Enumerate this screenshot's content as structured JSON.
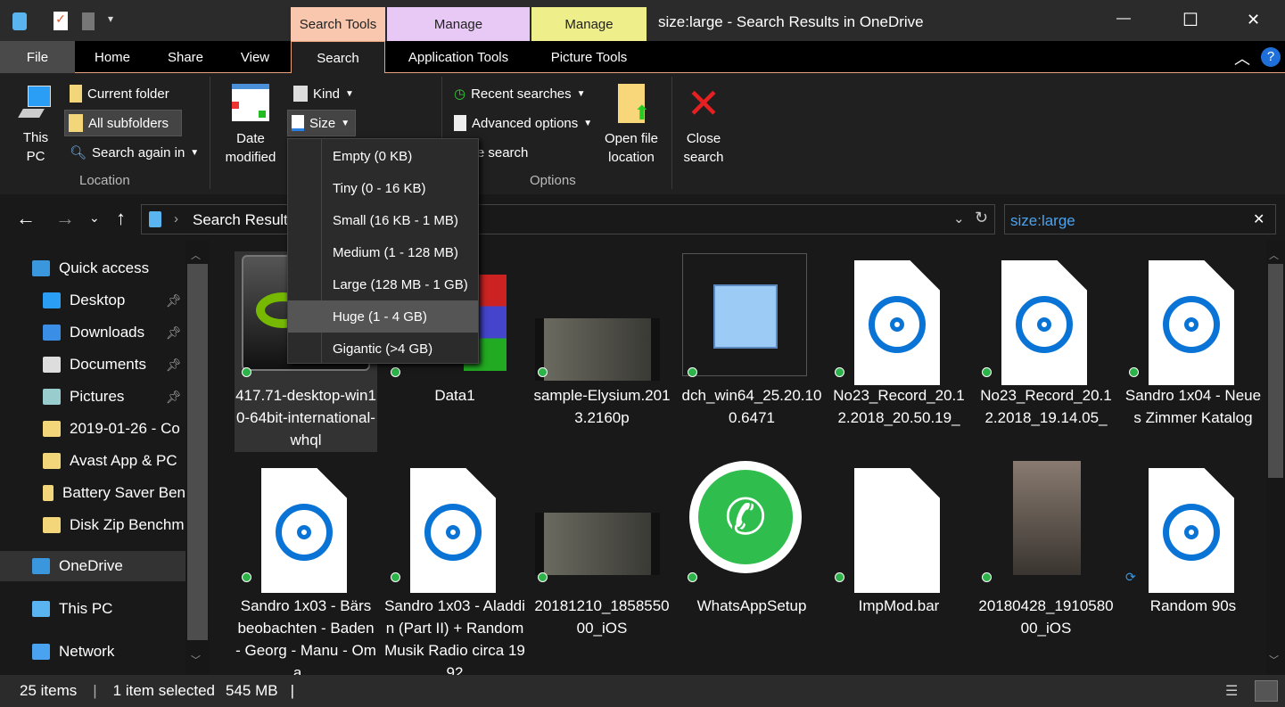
{
  "window": {
    "title": "size:large - Search Results in OneDrive",
    "minimize": "—",
    "maximize": "☐",
    "close": "✕"
  },
  "context_tabs": [
    {
      "label": "Search Tools",
      "color": "#f9c7ae"
    },
    {
      "label": "Manage",
      "color": "#e8c8f5"
    },
    {
      "label": "Manage",
      "color": "#eeee8a"
    }
  ],
  "tabs": [
    "File",
    "Home",
    "Share",
    "View",
    "Search",
    "Application Tools",
    "Picture Tools"
  ],
  "ribbon": {
    "location": {
      "this_pc": "This PC",
      "current_folder": "Current folder",
      "all_subfolders": "All subfolders",
      "search_again_in": "Search again in",
      "group": "Location"
    },
    "refine": {
      "date_modified": "Date modified",
      "kind": "Kind",
      "size": "Size"
    },
    "options": {
      "recent_searches": "Recent searches",
      "advanced_options": "Advanced options",
      "save_search": "Save search",
      "open_file_location": "Open file location",
      "group": "Options"
    },
    "close_search": "Close search"
  },
  "size_menu": [
    "Empty (0 KB)",
    "Tiny (0 - 16 KB)",
    "Small (16 KB - 1 MB)",
    "Medium (1 - 128 MB)",
    "Large (128 MB - 1 GB)",
    "Huge (1 - 4 GB)",
    "Gigantic (>4 GB)"
  ],
  "size_menu_hovered": "Huge (1 - 4 GB)",
  "address": {
    "path": "Search Results in OneDrive",
    "search_value": "size:large"
  },
  "nav": [
    {
      "label": "Quick access",
      "icon": "star-icon"
    },
    {
      "label": "Desktop",
      "icon": "desktop-icon",
      "pinned": true
    },
    {
      "label": "Downloads",
      "icon": "download-icon",
      "pinned": true
    },
    {
      "label": "Documents",
      "icon": "documents-icon",
      "pinned": true
    },
    {
      "label": "Pictures",
      "icon": "pictures-icon",
      "pinned": true
    },
    {
      "label": "2019-01-26 - Co",
      "icon": "folder-icon"
    },
    {
      "label": "Avast App & PC",
      "icon": "folder-icon"
    },
    {
      "label": "Battery Saver Ben",
      "icon": "folder-icon"
    },
    {
      "label": "Disk Zip Benchm",
      "icon": "folder-icon"
    },
    {
      "label": "OneDrive",
      "icon": "onedrive-icon"
    },
    {
      "label": "This PC",
      "icon": "pc-icon"
    },
    {
      "label": "Network",
      "icon": "network-icon"
    }
  ],
  "files": [
    {
      "name": "417.71-desktop-win10-64bit-international-whql",
      "type": "nvidia",
      "selected": true
    },
    {
      "name": "Data1",
      "type": "archive"
    },
    {
      "name": "sample-Elysium.2013.2160p",
      "type": "video"
    },
    {
      "name": "dch_win64_25.20.100.6471",
      "type": "installer"
    },
    {
      "name": "No23_Record_20.12.2018_20.50.19_",
      "type": "music"
    },
    {
      "name": "No23_Record_20.12.2018_19.14.05_",
      "type": "music"
    },
    {
      "name": "Sandro 1x04 - Neues Zimmer Katalog",
      "type": "music"
    },
    {
      "name": "Sandro 1x03 - Bärs beobachten - Baden - Georg - Manu - Oma ...",
      "type": "music"
    },
    {
      "name": "Sandro 1x03 - Aladdin (Part II) + Random Musik Radio circa 1992",
      "type": "music"
    },
    {
      "name": "20181210_185855000_iOS",
      "type": "video"
    },
    {
      "name": "WhatsAppSetup",
      "type": "whatsapp"
    },
    {
      "name": "ImpMod.bar",
      "type": "blank"
    },
    {
      "name": "20180428_191058000_iOS",
      "type": "photo"
    },
    {
      "name": "Random 90s",
      "type": "music",
      "syncing": true
    }
  ],
  "status": {
    "items": "25 items",
    "selected": "1 item selected",
    "size": "545 MB"
  }
}
